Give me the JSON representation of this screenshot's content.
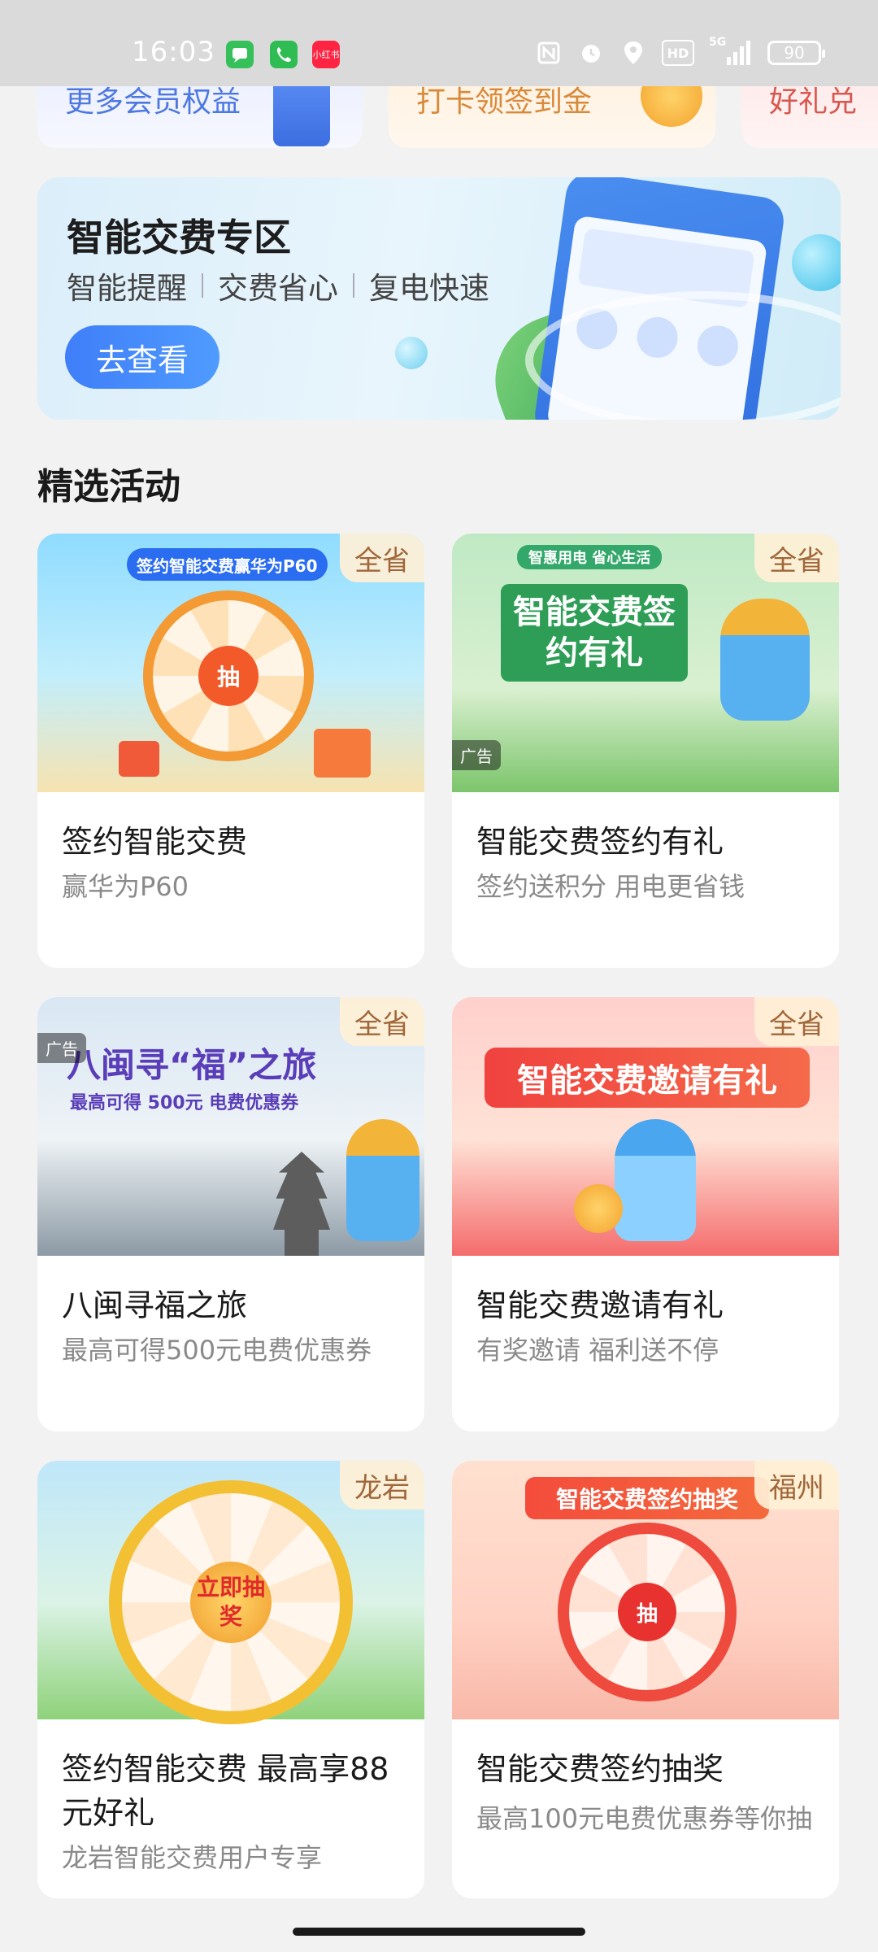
{
  "status_bar": {
    "time": "16:03",
    "notifications": [
      {
        "icon": "messages-app-icon",
        "color": "#35c05a"
      },
      {
        "icon": "phone-app-icon",
        "color": "#2fbd53"
      },
      {
        "icon": "xiaohongshu-app-icon",
        "color": "#ff2442",
        "label": "小红书"
      }
    ],
    "icons": [
      "nfc-icon",
      "alarm-icon",
      "location-icon",
      "hd-icon",
      "5g-signal-icon"
    ],
    "network_label": "5G",
    "hd_label": "HD",
    "battery": "90"
  },
  "top_cards": [
    {
      "label": "更多会员权益",
      "color": "#4d78e0"
    },
    {
      "label": "打卡领签到金",
      "color": "#d88a3a"
    },
    {
      "label": "好礼兑",
      "color": "#d8574f"
    }
  ],
  "banner": {
    "title": "智能交费专区",
    "subs": [
      "智能提醒",
      "交费省心",
      "复电快速"
    ],
    "button": "去查看"
  },
  "section_title": "精选活动",
  "activities": [
    {
      "region": "全省",
      "title": "签约智能交费",
      "subtitle": "赢华为P60",
      "image_text": "签约智能交费赢华为P60",
      "wheel_text": "抽",
      "ad": false
    },
    {
      "region": "全省",
      "title": "智能交费签约有礼",
      "subtitle": "签约送积分 用电更省钱",
      "image_text": "智能交费签约有礼",
      "image_tagline": "智惠用电 省心生活",
      "ad": true,
      "ad_label": "广告"
    },
    {
      "region": "全省",
      "title": "八闽寻福之旅",
      "subtitle": "最高可得500元电费优惠券",
      "image_text": "八闽寻“福”之旅",
      "image_tagline": "最高可得 500元 电费优惠券",
      "ad": true,
      "ad_label": "广告"
    },
    {
      "region": "全省",
      "title": "智能交费邀请有礼",
      "subtitle": "有奖邀请 福利送不停",
      "image_text": "智能交费邀请有礼",
      "ad": false
    },
    {
      "region": "龙岩",
      "title": "签约智能交费 最高享88元好礼",
      "subtitle": "龙岩智能交费用户专享",
      "wheel_text": "立即抽奖",
      "ad": false
    },
    {
      "region": "福州",
      "title": "智能交费签约抽奖",
      "subtitle": "最高100元电费优惠券等你抽",
      "image_text": "智能交费签约抽奖",
      "wheel_text": "抽",
      "ad": false
    }
  ]
}
